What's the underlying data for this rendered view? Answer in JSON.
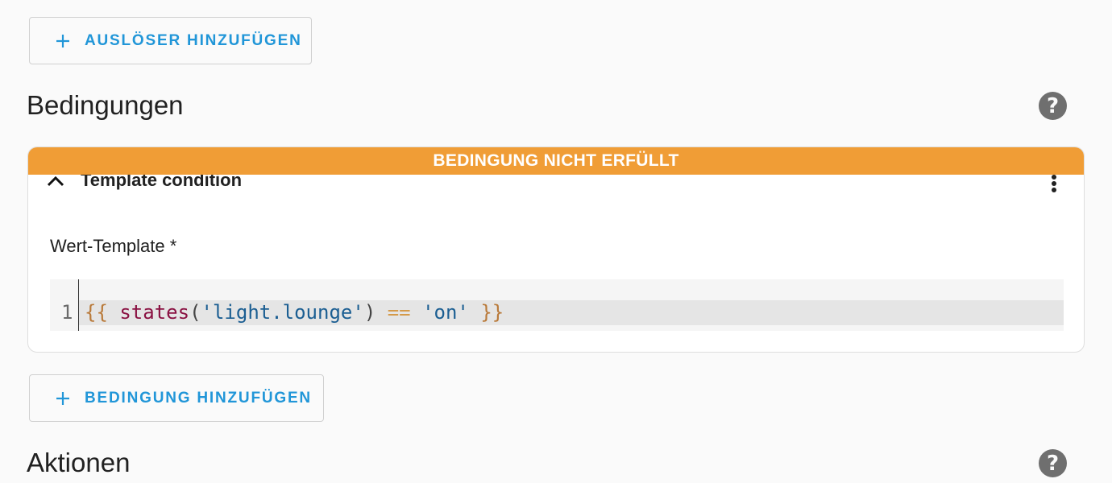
{
  "triggers": {
    "add_button_label": "AUSLÖSER HINZUFÜGEN",
    "add_icon": "plus-icon"
  },
  "conditions": {
    "title": "Bedingungen",
    "help_icon": "help-circle-icon",
    "card": {
      "status_banner": "BEDINGUNG NICHT ERFÜLLT",
      "banner_color": "#f09d36",
      "title": "Template condition",
      "collapse_icon": "chevron-up-icon",
      "menu_icon": "more-vertical-icon",
      "field_label": "Wert-Template *",
      "editor": {
        "line_number": "1",
        "tokens": {
          "open": "{{",
          "fn": "states",
          "paren_open": "(",
          "arg": "'light.lounge'",
          "paren_close": ")",
          "op": "==",
          "value": "'on'",
          "close": "}}"
        }
      }
    },
    "add_button_label": "BEDINGUNG HINZUFÜGEN",
    "add_icon": "plus-icon"
  },
  "actions": {
    "title": "Aktionen",
    "help_icon": "help-circle-icon"
  },
  "colors": {
    "accent": "#2196d8",
    "warning": "#f09d36"
  }
}
